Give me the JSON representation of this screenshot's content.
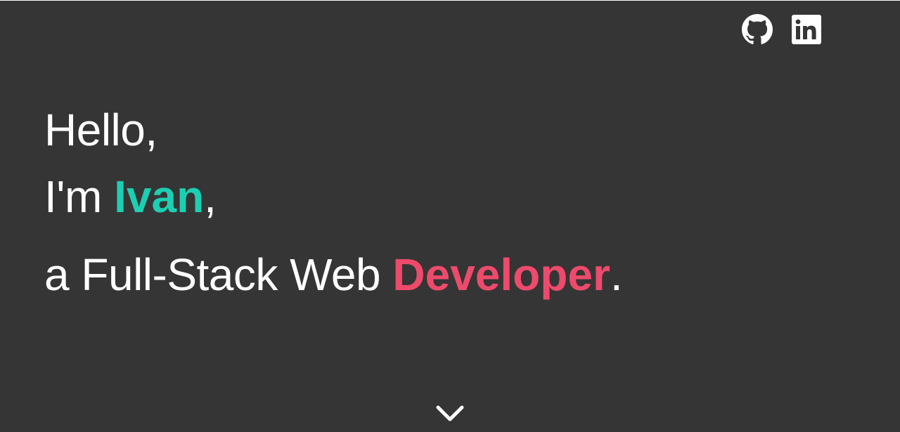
{
  "social": {
    "github_icon": "github-icon",
    "linkedin_icon": "linkedin-icon"
  },
  "headline": {
    "line1": "Hello,",
    "line2_prefix": "I'm ",
    "name": "Ivan",
    "line2_suffix": ",",
    "line3_prefix": "a Full-Stack Web ",
    "role": "Developer",
    "line3_suffix": "."
  },
  "scroll_icon": "chevron-down-icon",
  "colors": {
    "background": "#353535",
    "text": "#ffffff",
    "name_accent": "#1ccfb2",
    "role_accent": "#ee4a6c"
  }
}
